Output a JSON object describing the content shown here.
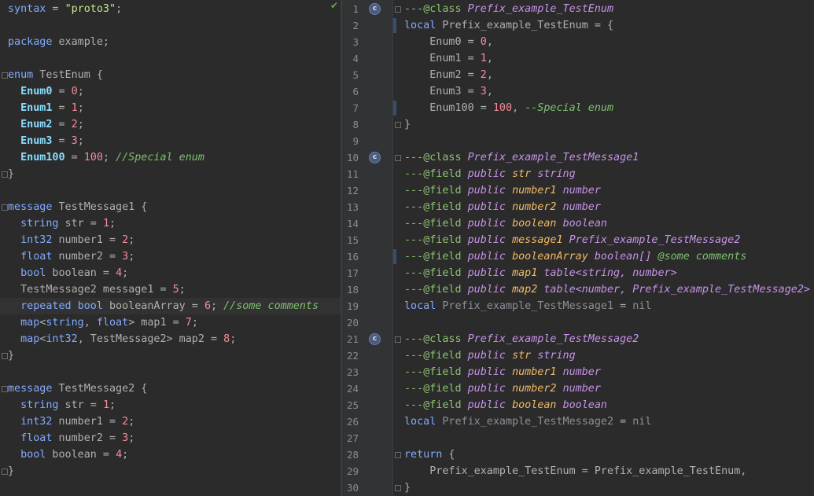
{
  "left_editor": {
    "file_status": "✔",
    "lines": [
      [
        [
          "k",
          "syntax"
        ],
        [
          "d",
          " = "
        ],
        [
          "s",
          "\"proto3\""
        ],
        [
          "d",
          ";"
        ]
      ],
      [],
      [
        [
          "k",
          "package"
        ],
        [
          "d",
          " example;"
        ]
      ],
      [],
      [
        [
          "k",
          "enum"
        ],
        [
          "d",
          " TestEnum {"
        ]
      ],
      [
        [
          "d",
          "  "
        ],
        [
          "e",
          "Enum0"
        ],
        [
          "d",
          " = "
        ],
        [
          "n",
          "0"
        ],
        [
          "d",
          ";"
        ]
      ],
      [
        [
          "d",
          "  "
        ],
        [
          "e",
          "Enum1"
        ],
        [
          "d",
          " = "
        ],
        [
          "n",
          "1"
        ],
        [
          "d",
          ";"
        ]
      ],
      [
        [
          "d",
          "  "
        ],
        [
          "e",
          "Enum2"
        ],
        [
          "d",
          " = "
        ],
        [
          "n",
          "2"
        ],
        [
          "d",
          ";"
        ]
      ],
      [
        [
          "d",
          "  "
        ],
        [
          "e",
          "Enum3"
        ],
        [
          "d",
          " = "
        ],
        [
          "n",
          "3"
        ],
        [
          "d",
          ";"
        ]
      ],
      [
        [
          "d",
          "  "
        ],
        [
          "e",
          "Enum100"
        ],
        [
          "d",
          " = "
        ],
        [
          "n",
          "100"
        ],
        [
          "d",
          "; "
        ],
        [
          "c",
          "//Special enum"
        ]
      ],
      [
        [
          "d",
          "}"
        ]
      ],
      [],
      [
        [
          "k",
          "message"
        ],
        [
          "d",
          " TestMessage1 {"
        ]
      ],
      [
        [
          "d",
          "  "
        ],
        [
          "k",
          "string"
        ],
        [
          "d",
          " str = "
        ],
        [
          "n",
          "1"
        ],
        [
          "d",
          ";"
        ]
      ],
      [
        [
          "d",
          "  "
        ],
        [
          "k",
          "int32"
        ],
        [
          "d",
          " number1 = "
        ],
        [
          "n",
          "2"
        ],
        [
          "d",
          ";"
        ]
      ],
      [
        [
          "d",
          "  "
        ],
        [
          "k",
          "float"
        ],
        [
          "d",
          " number2 = "
        ],
        [
          "n",
          "3"
        ],
        [
          "d",
          ";"
        ]
      ],
      [
        [
          "d",
          "  "
        ],
        [
          "k",
          "bool"
        ],
        [
          "d",
          " boolean = "
        ],
        [
          "n",
          "4"
        ],
        [
          "d",
          ";"
        ]
      ],
      [
        [
          "d",
          "  TestMessage2 message1 = "
        ],
        [
          "n",
          "5"
        ],
        [
          "d",
          ";"
        ]
      ],
      [
        [
          "d",
          "  "
        ],
        [
          "k",
          "repeated"
        ],
        [
          "d",
          " "
        ],
        [
          "k",
          "bool"
        ],
        [
          "d",
          " booleanArray = "
        ],
        [
          "n",
          "6"
        ],
        [
          "d",
          "; "
        ],
        [
          "c",
          "//some comments"
        ]
      ],
      [
        [
          "d",
          "  "
        ],
        [
          "k",
          "map"
        ],
        [
          "d",
          "<"
        ],
        [
          "k",
          "string"
        ],
        [
          "d",
          ", "
        ],
        [
          "k",
          "float"
        ],
        [
          "d",
          "> map1 = "
        ],
        [
          "n",
          "7"
        ],
        [
          "d",
          ";"
        ]
      ],
      [
        [
          "d",
          "  "
        ],
        [
          "k",
          "map"
        ],
        [
          "d",
          "<"
        ],
        [
          "k",
          "int32"
        ],
        [
          "d",
          ", TestMessage2> map2 = "
        ],
        [
          "n",
          "8"
        ],
        [
          "d",
          ";"
        ]
      ],
      [
        [
          "d",
          "}"
        ]
      ],
      [],
      [
        [
          "k",
          "message"
        ],
        [
          "d",
          " TestMessage2 {"
        ]
      ],
      [
        [
          "d",
          "  "
        ],
        [
          "k",
          "string"
        ],
        [
          "d",
          " str = "
        ],
        [
          "n",
          "1"
        ],
        [
          "d",
          ";"
        ]
      ],
      [
        [
          "d",
          "  "
        ],
        [
          "k",
          "int32"
        ],
        [
          "d",
          " number1 = "
        ],
        [
          "n",
          "2"
        ],
        [
          "d",
          ";"
        ]
      ],
      [
        [
          "d",
          "  "
        ],
        [
          "k",
          "float"
        ],
        [
          "d",
          " number2 = "
        ],
        [
          "n",
          "3"
        ],
        [
          "d",
          ";"
        ]
      ],
      [
        [
          "d",
          "  "
        ],
        [
          "k",
          "bool"
        ],
        [
          "d",
          " boolean = "
        ],
        [
          "n",
          "4"
        ],
        [
          "d",
          ";"
        ]
      ],
      [
        [
          "d",
          "}"
        ]
      ]
    ]
  },
  "right_editor": {
    "class_icon_label": "c",
    "lines": [
      {
        "num": "1",
        "icon": true,
        "tokens": [
          [
            "dash",
            "---"
          ],
          [
            "at",
            "@class"
          ],
          [
            "d",
            " "
          ],
          [
            "tn",
            "Prefix_example_TestEnum"
          ]
        ]
      },
      {
        "num": "2",
        "tokens": [
          [
            "k",
            "local"
          ],
          [
            "d",
            " Prefix_example_TestEnum = {"
          ]
        ]
      },
      {
        "num": "3",
        "tokens": [
          [
            "d",
            "    Enum0 = "
          ],
          [
            "n",
            "0"
          ],
          [
            "d",
            ","
          ]
        ]
      },
      {
        "num": "4",
        "tokens": [
          [
            "d",
            "    Enum1 = "
          ],
          [
            "n",
            "1"
          ],
          [
            "d",
            ","
          ]
        ]
      },
      {
        "num": "5",
        "tokens": [
          [
            "d",
            "    Enum2 = "
          ],
          [
            "n",
            "2"
          ],
          [
            "d",
            ","
          ]
        ]
      },
      {
        "num": "6",
        "tokens": [
          [
            "d",
            "    Enum3 = "
          ],
          [
            "n",
            "3"
          ],
          [
            "d",
            ","
          ]
        ]
      },
      {
        "num": "7",
        "tokens": [
          [
            "d",
            "    Enum100 = "
          ],
          [
            "n",
            "100"
          ],
          [
            "d",
            ", "
          ],
          [
            "c",
            "--Special enum"
          ]
        ]
      },
      {
        "num": "8",
        "tokens": [
          [
            "d",
            "}"
          ]
        ]
      },
      {
        "num": "9",
        "tokens": []
      },
      {
        "num": "10",
        "icon": true,
        "tokens": [
          [
            "dash",
            "---"
          ],
          [
            "at",
            "@class"
          ],
          [
            "d",
            " "
          ],
          [
            "tn",
            "Prefix_example_TestMessage1"
          ]
        ]
      },
      {
        "num": "11",
        "tokens": [
          [
            "dash",
            "---"
          ],
          [
            "at",
            "@field"
          ],
          [
            "d",
            " "
          ],
          [
            "tn",
            "public"
          ],
          [
            "d",
            " "
          ],
          [
            "fn",
            "str"
          ],
          [
            "d",
            " "
          ],
          [
            "tn",
            "string"
          ]
        ]
      },
      {
        "num": "12",
        "tokens": [
          [
            "dash",
            "---"
          ],
          [
            "at",
            "@field"
          ],
          [
            "d",
            " "
          ],
          [
            "tn",
            "public"
          ],
          [
            "d",
            " "
          ],
          [
            "fn",
            "number1"
          ],
          [
            "d",
            " "
          ],
          [
            "tn",
            "number"
          ]
        ]
      },
      {
        "num": "13",
        "tokens": [
          [
            "dash",
            "---"
          ],
          [
            "at",
            "@field"
          ],
          [
            "d",
            " "
          ],
          [
            "tn",
            "public"
          ],
          [
            "d",
            " "
          ],
          [
            "fn",
            "number2"
          ],
          [
            "d",
            " "
          ],
          [
            "tn",
            "number"
          ]
        ]
      },
      {
        "num": "14",
        "tokens": [
          [
            "dash",
            "---"
          ],
          [
            "at",
            "@field"
          ],
          [
            "d",
            " "
          ],
          [
            "tn",
            "public"
          ],
          [
            "d",
            " "
          ],
          [
            "fn",
            "boolean"
          ],
          [
            "d",
            " "
          ],
          [
            "tn",
            "boolean"
          ]
        ]
      },
      {
        "num": "15",
        "tokens": [
          [
            "dash",
            "---"
          ],
          [
            "at",
            "@field"
          ],
          [
            "d",
            " "
          ],
          [
            "tn",
            "public"
          ],
          [
            "d",
            " "
          ],
          [
            "fn",
            "message1"
          ],
          [
            "d",
            " "
          ],
          [
            "tn",
            "Prefix_example_TestMessage2"
          ]
        ]
      },
      {
        "num": "16",
        "tokens": [
          [
            "dash",
            "---"
          ],
          [
            "at",
            "@field"
          ],
          [
            "d",
            " "
          ],
          [
            "tn",
            "public"
          ],
          [
            "d",
            " "
          ],
          [
            "fn",
            "booleanArray"
          ],
          [
            "d",
            " "
          ],
          [
            "tn",
            "boolean[]"
          ],
          [
            "d",
            " "
          ],
          [
            "c",
            "@some comments"
          ]
        ]
      },
      {
        "num": "17",
        "tokens": [
          [
            "dash",
            "---"
          ],
          [
            "at",
            "@field"
          ],
          [
            "d",
            " "
          ],
          [
            "tn",
            "public"
          ],
          [
            "d",
            " "
          ],
          [
            "fn",
            "map1"
          ],
          [
            "d",
            " "
          ],
          [
            "tn",
            "table<string, number>"
          ]
        ]
      },
      {
        "num": "18",
        "tokens": [
          [
            "dash",
            "---"
          ],
          [
            "at",
            "@field"
          ],
          [
            "d",
            " "
          ],
          [
            "tn",
            "public"
          ],
          [
            "d",
            " "
          ],
          [
            "fn",
            "map2"
          ],
          [
            "d",
            " "
          ],
          [
            "tn",
            "table<number, Prefix_example_TestMessage2>"
          ]
        ]
      },
      {
        "num": "19",
        "tokens": [
          [
            "k",
            "local"
          ],
          [
            "d",
            " "
          ],
          [
            "ln",
            "Prefix_example_TestMessage1"
          ],
          [
            "d",
            " = "
          ],
          [
            "ln",
            "nil"
          ]
        ]
      },
      {
        "num": "20",
        "tokens": []
      },
      {
        "num": "21",
        "icon": true,
        "tokens": [
          [
            "dash",
            "---"
          ],
          [
            "at",
            "@class"
          ],
          [
            "d",
            " "
          ],
          [
            "tn",
            "Prefix_example_TestMessage2"
          ]
        ]
      },
      {
        "num": "22",
        "tokens": [
          [
            "dash",
            "---"
          ],
          [
            "at",
            "@field"
          ],
          [
            "d",
            " "
          ],
          [
            "tn",
            "public"
          ],
          [
            "d",
            " "
          ],
          [
            "fn",
            "str"
          ],
          [
            "d",
            " "
          ],
          [
            "tn",
            "string"
          ]
        ]
      },
      {
        "num": "23",
        "tokens": [
          [
            "dash",
            "---"
          ],
          [
            "at",
            "@field"
          ],
          [
            "d",
            " "
          ],
          [
            "tn",
            "public"
          ],
          [
            "d",
            " "
          ],
          [
            "fn",
            "number1"
          ],
          [
            "d",
            " "
          ],
          [
            "tn",
            "number"
          ]
        ]
      },
      {
        "num": "24",
        "tokens": [
          [
            "dash",
            "---"
          ],
          [
            "at",
            "@field"
          ],
          [
            "d",
            " "
          ],
          [
            "tn",
            "public"
          ],
          [
            "d",
            " "
          ],
          [
            "fn",
            "number2"
          ],
          [
            "d",
            " "
          ],
          [
            "tn",
            "number"
          ]
        ]
      },
      {
        "num": "25",
        "tokens": [
          [
            "dash",
            "---"
          ],
          [
            "at",
            "@field"
          ],
          [
            "d",
            " "
          ],
          [
            "tn",
            "public"
          ],
          [
            "d",
            " "
          ],
          [
            "fn",
            "boolean"
          ],
          [
            "d",
            " "
          ],
          [
            "tn",
            "boolean"
          ]
        ]
      },
      {
        "num": "26",
        "tokens": [
          [
            "k",
            "local"
          ],
          [
            "d",
            " "
          ],
          [
            "ln",
            "Prefix_example_TestMessage2"
          ],
          [
            "d",
            " = "
          ],
          [
            "ln",
            "nil"
          ]
        ]
      },
      {
        "num": "27",
        "tokens": []
      },
      {
        "num": "28",
        "tokens": [
          [
            "k",
            "return"
          ],
          [
            "d",
            " {"
          ]
        ]
      },
      {
        "num": "29",
        "tokens": [
          [
            "d",
            "    Prefix_example_TestEnum = Prefix_example_TestEnum,"
          ]
        ]
      },
      {
        "num": "30",
        "tokens": [
          [
            "d",
            "}"
          ]
        ]
      }
    ]
  }
}
